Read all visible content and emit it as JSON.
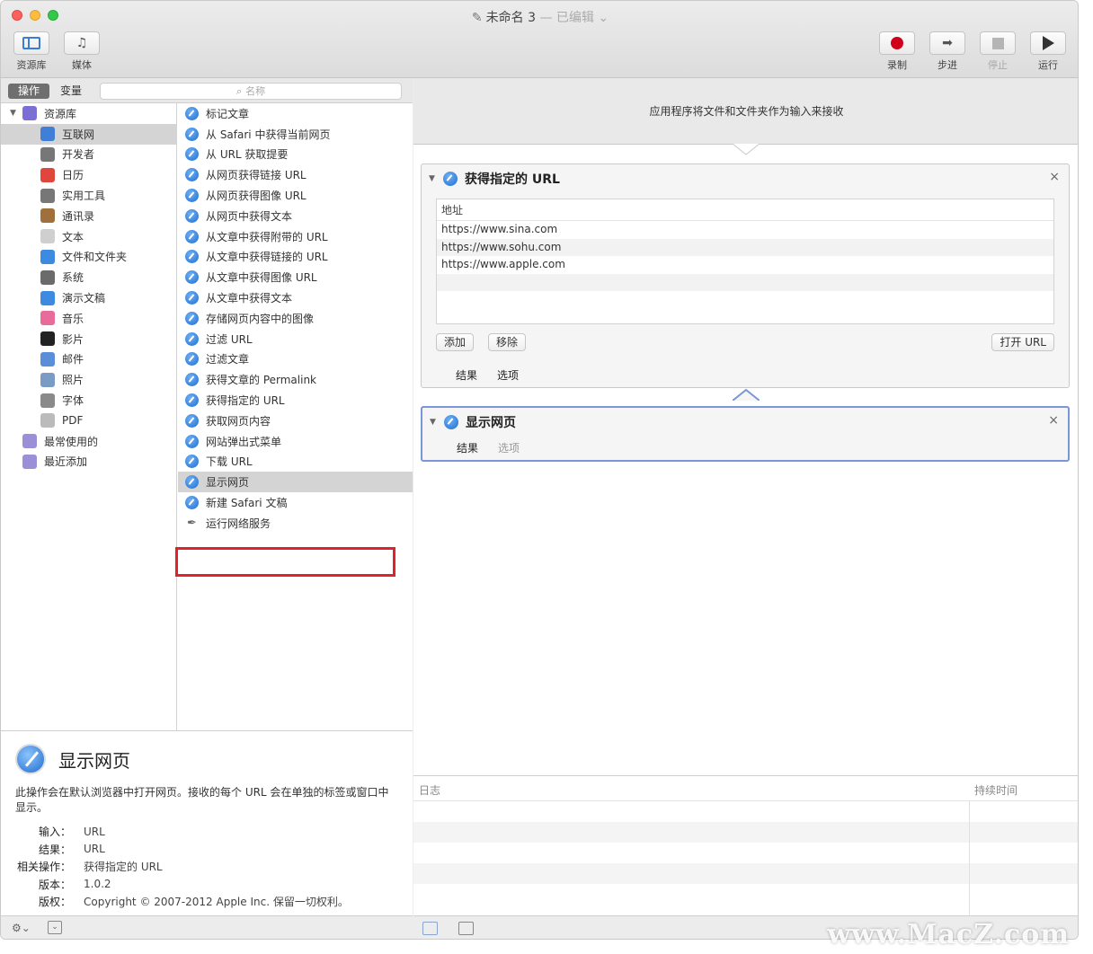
{
  "window": {
    "title": "未命名 3",
    "edited": "— 已编辑 ⌄"
  },
  "toolbar": {
    "library_label": "资源库",
    "media_label": "媒体",
    "record_label": "录制",
    "step_label": "步进",
    "stop_label": "停止",
    "run_label": "运行"
  },
  "library": {
    "actions_tab": "操作",
    "variables_tab": "变量",
    "search_placeholder": "名称",
    "categories": [
      {
        "label": "资源库",
        "icon": "library-icon",
        "color": "#7b6fd6"
      },
      {
        "label": "互联网",
        "icon": "internet-icon",
        "color": "#3f7fd8"
      },
      {
        "label": "开发者",
        "icon": "developer-icon",
        "color": "#777777"
      },
      {
        "label": "日历",
        "icon": "calendar-icon",
        "color": "#e0463c"
      },
      {
        "label": "实用工具",
        "icon": "utilities-icon",
        "color": "#777777"
      },
      {
        "label": "通讯录",
        "icon": "contacts-icon",
        "color": "#a0703a"
      },
      {
        "label": "文本",
        "icon": "text-icon",
        "color": "#cfcfcf"
      },
      {
        "label": "文件和文件夹",
        "icon": "finder-icon",
        "color": "#3c8be0"
      },
      {
        "label": "系统",
        "icon": "system-icon",
        "color": "#6b6b6b"
      },
      {
        "label": "演示文稿",
        "icon": "presentation-icon",
        "color": "#3c8be0"
      },
      {
        "label": "音乐",
        "icon": "music-icon",
        "color": "#e86b9b"
      },
      {
        "label": "影片",
        "icon": "movie-icon",
        "color": "#222222"
      },
      {
        "label": "邮件",
        "icon": "mail-icon",
        "color": "#5b8ed8"
      },
      {
        "label": "照片",
        "icon": "photos-icon",
        "color": "#7a9bc4"
      },
      {
        "label": "字体",
        "icon": "fonts-icon",
        "color": "#8a8a8a"
      },
      {
        "label": "PDF",
        "icon": "pdf-icon",
        "color": "#bbbbbb"
      },
      {
        "label": "最常使用的",
        "icon": "smart-folder-icon",
        "color": "#9b8fd8"
      },
      {
        "label": "最近添加",
        "icon": "smart-folder-icon",
        "color": "#9b8fd8"
      }
    ],
    "actions": [
      "标记文章",
      "从 Safari 中获得当前网页",
      "从 URL 获取提要",
      "从网页获得链接 URL",
      "从网页获得图像 URL",
      "从网页中获得文本",
      "从文章中获得附带的 URL",
      "从文章中获得链接的 URL",
      "从文章中获得图像 URL",
      "从文章中获得文本",
      "存储网页内容中的图像",
      "过滤 URL",
      "过滤文章",
      "获得文章的 Permalink",
      "获得指定的 URL",
      "获取网页内容",
      "网站弹出式菜单",
      "下载 URL",
      "显示网页",
      "新建 Safari 文稿",
      "运行网络服务"
    ]
  },
  "description": {
    "title": "显示网页",
    "text": "此操作会在默认浏览器中打开网页。接收的每个 URL 会在单独的标签或窗口中显示。",
    "meta": [
      {
        "k": "输入：",
        "v": "URL"
      },
      {
        "k": "结果：",
        "v": "URL"
      },
      {
        "k": "相关操作：",
        "v": "获得指定的 URL"
      },
      {
        "k": "版本：",
        "v": "1.0.2"
      },
      {
        "k": "版权：",
        "v": "Copyright © 2007-2012 Apple Inc. 保留一切权利。"
      }
    ]
  },
  "workflow": {
    "receives_text": "应用程序将文件和文件夹作为输入来接收",
    "card1": {
      "title": "获得指定的 URL",
      "column_header": "地址",
      "urls": [
        "https://www.sina.com",
        "https://www.sohu.com",
        "https://www.apple.com"
      ],
      "add_label": "添加",
      "remove_label": "移除",
      "open_label": "打开 URL",
      "results_tab": "结果",
      "options_tab": "选项"
    },
    "card2": {
      "title": "显示网页",
      "results_tab": "结果",
      "options_tab": "选项"
    }
  },
  "log": {
    "col_log": "日志",
    "col_duration": "持续时间"
  },
  "watermark": "www.MacZ.com"
}
